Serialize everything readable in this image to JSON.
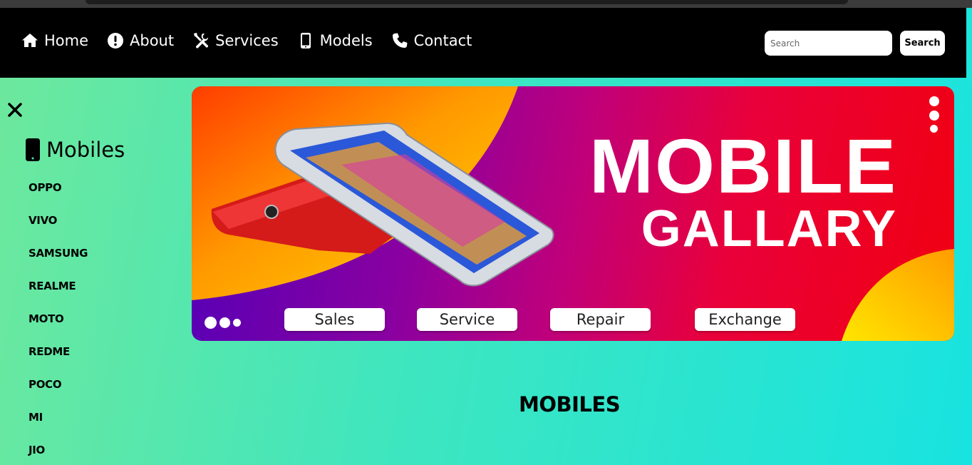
{
  "nav": {
    "links": [
      {
        "label": "Home",
        "icon": "home-icon"
      },
      {
        "label": "About",
        "icon": "info-icon"
      },
      {
        "label": "Services",
        "icon": "tools-icon"
      },
      {
        "label": "Models",
        "icon": "mobile-icon"
      },
      {
        "label": "Contact",
        "icon": "phone-icon"
      }
    ],
    "search_placeholder": "Search",
    "search_button": "Search"
  },
  "sidebar": {
    "title": "Mobiles",
    "brands": [
      "OPPO",
      "VIVO",
      "SAMSUNG",
      "REALME",
      "MOTO",
      "REDME",
      "POCO",
      "MI",
      "JIO"
    ]
  },
  "banner": {
    "title": "MOBILE",
    "subtitle": "GALLARY",
    "pills": [
      "Sales",
      "Service",
      "Repair",
      "Exchange"
    ]
  },
  "main": {
    "section_heading": "MOBILES"
  },
  "colors": {
    "navbar": "#000000",
    "bg_start": "#6ee89c",
    "bg_end": "#18e3e0",
    "banner_red": "#f10010",
    "banner_purple": "#5200b8",
    "banner_yellow": "#ffd400"
  }
}
